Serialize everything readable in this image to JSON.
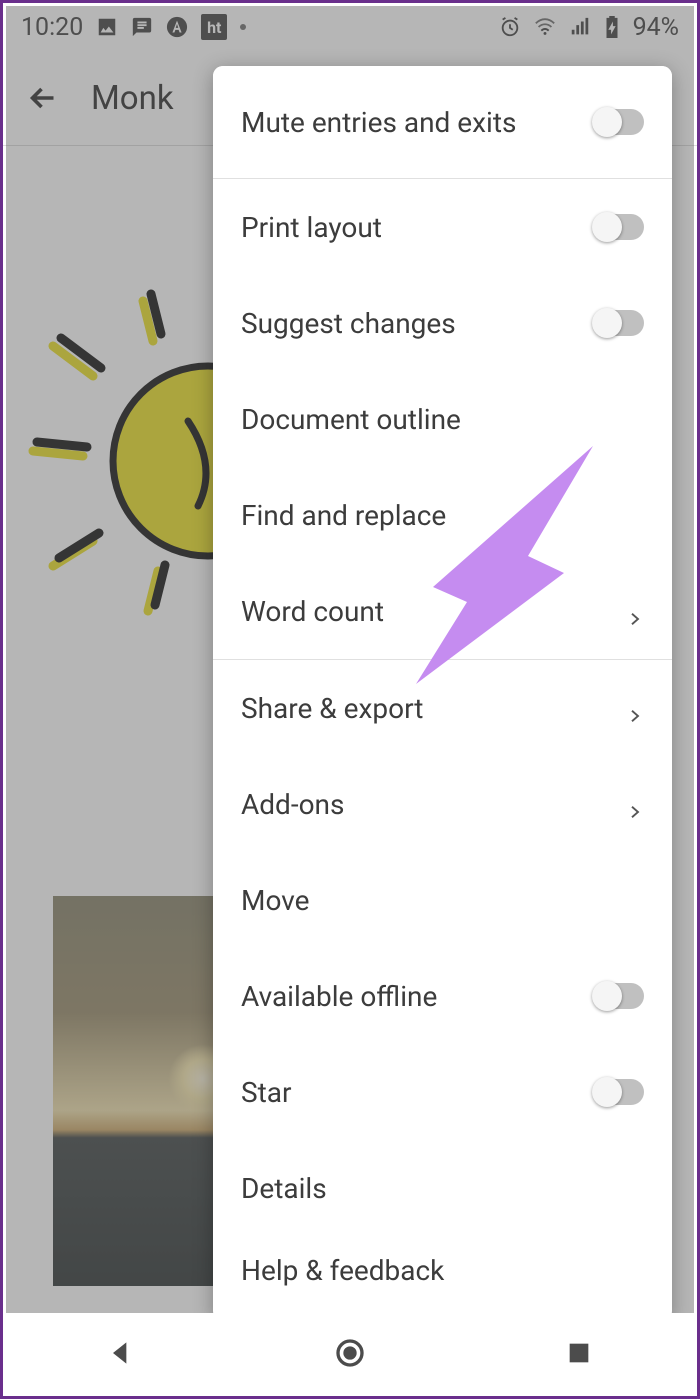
{
  "status": {
    "time": "10:20",
    "battery": "94%"
  },
  "appbar": {
    "title_visible": "Monk"
  },
  "menu": {
    "mute": "Mute entries and exits",
    "print_layout": "Print layout",
    "suggest": "Suggest changes",
    "outline": "Document outline",
    "find": "Find and replace",
    "word_count": "Word count",
    "share_export": "Share & export",
    "addons": "Add-ons",
    "move": "Move",
    "offline": "Available offline",
    "star": "Star",
    "details": "Details",
    "help": "Help & feedback"
  }
}
